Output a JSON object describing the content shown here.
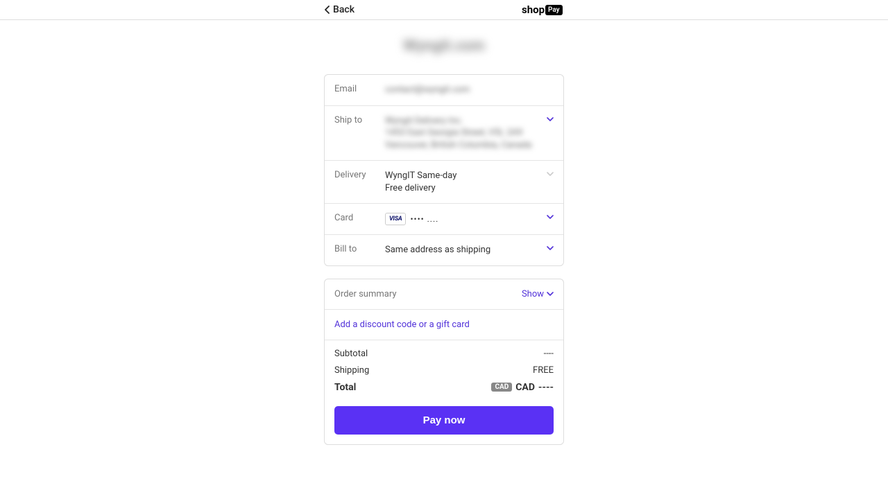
{
  "header": {
    "back_label": "Back",
    "logo_text": "shop",
    "logo_badge": "Pay"
  },
  "store_name": "Wyngit.com",
  "info": {
    "email": {
      "label": "Email",
      "value": "contact@wyngit.com"
    },
    "ship_to": {
      "label": "Ship to",
      "line1": "Wyngit Delivery Inc.",
      "line2": "1453 East Georgia Street, V5L 2A9",
      "line3": "Vancouver, British Columbia, Canada"
    },
    "delivery": {
      "label": "Delivery",
      "line1": "WyngIT Same-day",
      "line2": "Free delivery"
    },
    "card": {
      "label": "Card",
      "brand": "VISA",
      "dots": "•••• ...."
    },
    "bill_to": {
      "label": "Bill to",
      "value": "Same address as shipping"
    }
  },
  "summary": {
    "header_label": "Order summary",
    "show_label": "Show",
    "discount_link": "Add a discount code or a gift card",
    "subtotal_label": "Subtotal",
    "subtotal_value": "----",
    "shipping_label": "Shipping",
    "shipping_value": "FREE",
    "total_label": "Total",
    "currency_badge": "CAD",
    "total_currency": "CAD",
    "total_value": "----",
    "pay_button": "Pay now"
  }
}
